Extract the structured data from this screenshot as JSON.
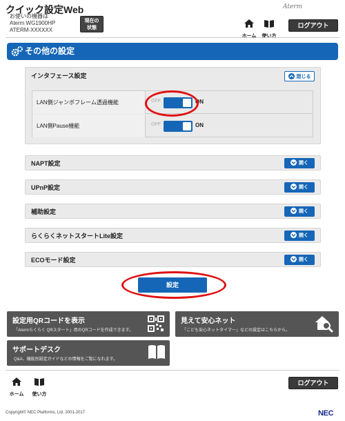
{
  "header": {
    "title": "クイック設定Web",
    "device_lines": [
      "お使いの機器は",
      "Aterm WG1900HP",
      "ATERM-XXXXXX"
    ],
    "status_button_lines": [
      "現在の",
      "状態"
    ],
    "brand": "Aterm",
    "home_label": "ホーム",
    "guide_label": "使い方",
    "logout_label": "ログアウト"
  },
  "page": {
    "section_title": "その他の設定",
    "apply_label": "設定"
  },
  "interface_panel": {
    "title": "インタフェース設定",
    "toggle_label": "閉じる",
    "rows": [
      {
        "label": "LAN側ジャンボフレーム透過機能",
        "off": "OFF",
        "on": "ON",
        "state": "on"
      },
      {
        "label": "LAN側Pause機能",
        "off": "OFF",
        "on": "ON",
        "state": "on"
      }
    ]
  },
  "collapsed_panels": [
    {
      "title": "NAPT設定",
      "toggle_label": "開く"
    },
    {
      "title": "UPnP設定",
      "toggle_label": "開く"
    },
    {
      "title": "補助設定",
      "toggle_label": "開く"
    },
    {
      "title": "らくらくネットスタートLite設定",
      "toggle_label": "開く"
    },
    {
      "title": "ECOモード設定",
      "toggle_label": "開く"
    }
  ],
  "cards": {
    "qr": {
      "title": "設定用QRコードを表示",
      "desc": "「Atermらくらく QRスタート」用のQRコードを作成できます。"
    },
    "safety": {
      "title": "見えて安心ネット",
      "desc": "「こども安心ネットタイマー」などの設定はこちらから。"
    },
    "support": {
      "title": "サポートデスク",
      "desc": "Q&A、機能別設定ガイドなどの情報をご覧になれます。"
    }
  },
  "footer": {
    "home_label": "ホーム",
    "guide_label": "使い方",
    "logout_label": "ログアウト",
    "copyright": "Copyright© NEC Platforms, Ltd. 2001-2017",
    "logo": "NEC"
  },
  "colors": {
    "accent": "#1566b7",
    "annotation": "#e01010",
    "card": "#555555"
  }
}
